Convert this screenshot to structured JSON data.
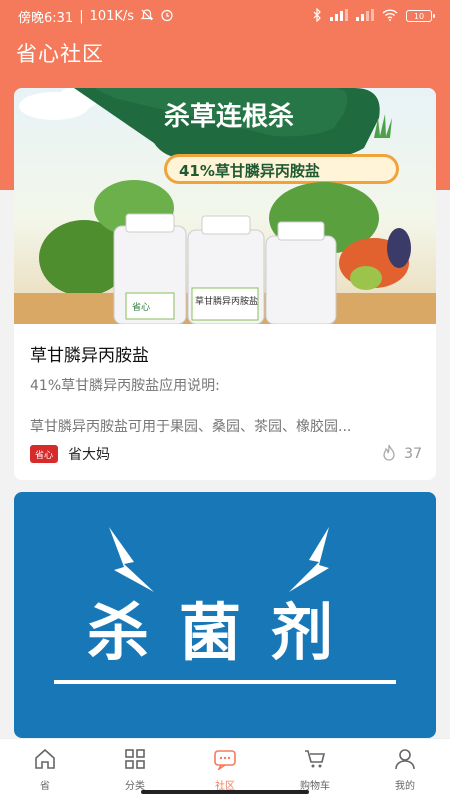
{
  "status_bar": {
    "time": "傍晚6:31",
    "network_speed": "101K/s",
    "battery": "10"
  },
  "app": {
    "title": "省心社区"
  },
  "posts": [
    {
      "banner_headline": "杀草连根杀",
      "banner_product": "41%草甘膦异丙胺盐",
      "bottle_brand": "省心",
      "bottle_label": "草甘膦异丙胺盐",
      "title": "草甘膦异丙胺盐",
      "desc1": "41%草甘膦异丙胺盐应用说明:",
      "desc2": "草甘膦异丙胺盐可用于果园、桑园、茶园、橡胶园...",
      "author_avatar": "省心",
      "author": "省大妈",
      "hot_count": "37"
    },
    {
      "banner_text": "杀菌剂"
    }
  ],
  "bottom_nav": [
    {
      "label": "省",
      "icon": "home-icon"
    },
    {
      "label": "分类",
      "icon": "grid-icon"
    },
    {
      "label": "社区",
      "icon": "chat-icon",
      "active": true
    },
    {
      "label": "购物车",
      "icon": "cart-icon"
    },
    {
      "label": "我的",
      "icon": "user-icon"
    }
  ],
  "colors": {
    "accent": "#f47a5b",
    "card2_bg": "#1878b7"
  }
}
